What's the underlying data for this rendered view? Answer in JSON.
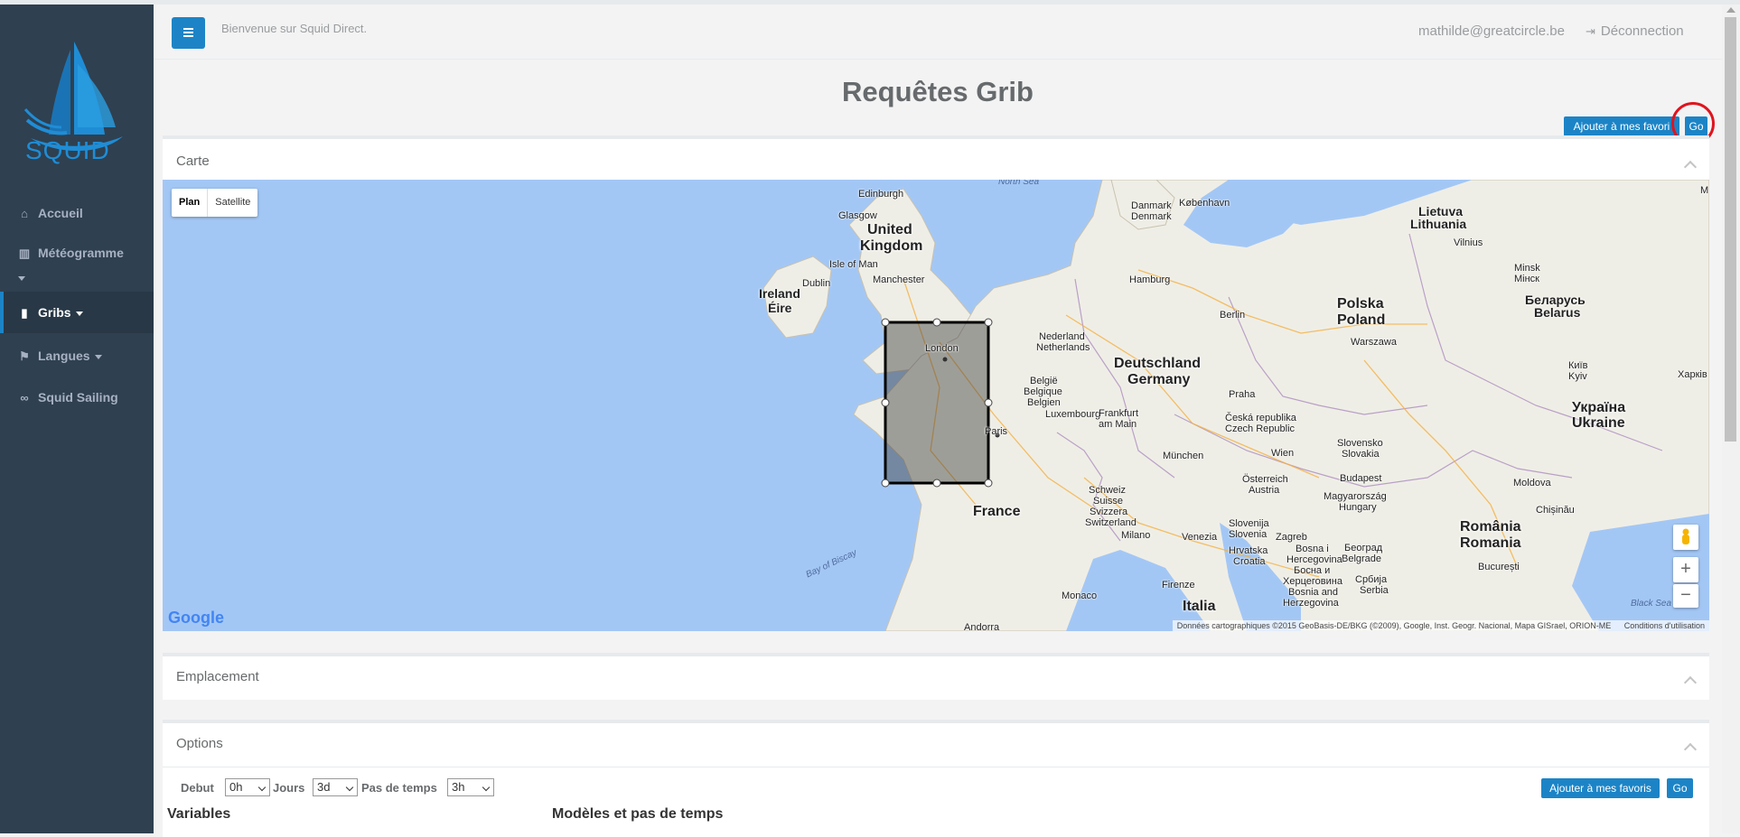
{
  "app": {
    "logo_text": "SQUID"
  },
  "sidebar": {
    "items": [
      {
        "label": "Accueil",
        "icon": "home-icon"
      },
      {
        "label": "Météogramme",
        "icon": "bar-chart-icon"
      },
      {
        "label": "Gribs",
        "icon": "file-icon"
      },
      {
        "label": "Langues",
        "icon": "language-icon"
      },
      {
        "label": "Squid Sailing",
        "icon": "link-icon"
      }
    ]
  },
  "topbar": {
    "welcome": "Bienvenue sur Squid Direct.",
    "user_email": "mathilde@greatcircle.be",
    "logout_label": "Déconnection"
  },
  "page": {
    "title": "Requêtes Grib",
    "favorites_label": "Ajouter à mes favoris",
    "favorites_label_truncated": "Ajouter à mes favori",
    "go_label": "Go"
  },
  "panels": {
    "map_title": "Carte",
    "location_title": "Emplacement",
    "options_title": "Options"
  },
  "map": {
    "type_plan": "Plan",
    "type_satellite": "Satellite",
    "zoom_in": "+",
    "zoom_out": "−",
    "attribution": "Données cartographiques ©2015 GeoBasis-DE/BKG (©2009), Google, Inst. Geogr. Nacional, Mapa GISrael, ORION-ME",
    "terms": "Conditions d'utilisation",
    "google": "Google",
    "labels": {
      "north_sea": "North Sea",
      "edinburgh": "Edinburgh",
      "glasgow": "Glasgow",
      "united": "United",
      "kingdom": "Kingdom",
      "isle_of_man": "Isle of Man",
      "ireland": "Ireland",
      "eire": "Éire",
      "dublin": "Dublin",
      "manchester": "Manchester",
      "london": "London",
      "danmark": "Danmark",
      "denmark": "Denmark",
      "kobenhavn": "København",
      "hamburg": "Hamburg",
      "nederland": "Nederland",
      "netherlands": "Netherlands",
      "belgie": "België",
      "belgique": "Belgique",
      "belgien": "Belgien",
      "luxembourg": "Luxembourg",
      "deutschland": "Deutschland",
      "germany": "Germany",
      "berlin": "Berlin",
      "polska": "Polska",
      "poland": "Poland",
      "warszawa": "Warszawa",
      "lietuva": "Lietuva",
      "lithuania": "Lithuania",
      "vilnius": "Vilnius",
      "minsk_lat": "Minsk",
      "minsk_cyr": "Мінск",
      "belarus_cyr": "Беларусь",
      "belarus": "Belarus",
      "kyiv_cyr": "Київ",
      "kyiv": "Kyiv",
      "kharkiv_cyr": "Харків",
      "ukraina": "Україна",
      "ukraine": "Ukraine",
      "paris": "Paris",
      "frankfurt": "Frankfurt",
      "am_main": "am Main",
      "praha": "Praha",
      "ceska": "Česká republika",
      "czech": "Czech Republic",
      "slovensko": "Slovensko",
      "slovakia": "Slovakia",
      "munchen": "München",
      "wien": "Wien",
      "osterreich": "Österreich",
      "austria": "Austria",
      "budapest": "Budapest",
      "magyarorszag": "Magyarország",
      "hungary": "Hungary",
      "moldova": "Moldova",
      "chisinau": "Chișinău",
      "france": "France",
      "bay_of_biscay": "Bay of Biscay",
      "schweiz": "Schweiz",
      "suisse": "Suisse",
      "svizzera": "Svizzera",
      "switzerland": "Switzerland",
      "milano": "Milano",
      "venezia": "Venezia",
      "slovenija": "Slovenija",
      "slovenia": "Slovenia",
      "zagreb": "Zagreb",
      "hrvatska": "Hrvatska",
      "croatia": "Croatia",
      "beograd": "Београд",
      "belgrade": "Belgrade",
      "srbija": "Србија",
      "serbia": "Serbia",
      "bosna1": "Bosna i",
      "bosna2": "Hercegovina",
      "bosna3": "Босна и",
      "bosna4": "Херцеговина",
      "bosna5": "Bosnia and",
      "bosna6": "Herzegovina",
      "romania_ro": "România",
      "romania": "Romania",
      "bucuresti": "București",
      "monaco": "Monaco",
      "firenze": "Firenze",
      "italia": "Italia",
      "andorra": "Andorra",
      "black_sea": "Black Sea",
      "m": "M"
    }
  },
  "options": {
    "debut_label": "Debut",
    "debut_value": "0h",
    "jours_label": "Jours",
    "jours_value": "3d",
    "pas_label": "Pas de temps",
    "pas_value": "3h",
    "variables_title": "Variables",
    "models_title": "Modèles et pas de temps"
  },
  "colors": {
    "sidebar_bg": "#2f4050",
    "primary": "#1c84c6",
    "sea": "#a3c7f5",
    "land": "#efeee6",
    "highlight_circle": "#e0141e"
  }
}
